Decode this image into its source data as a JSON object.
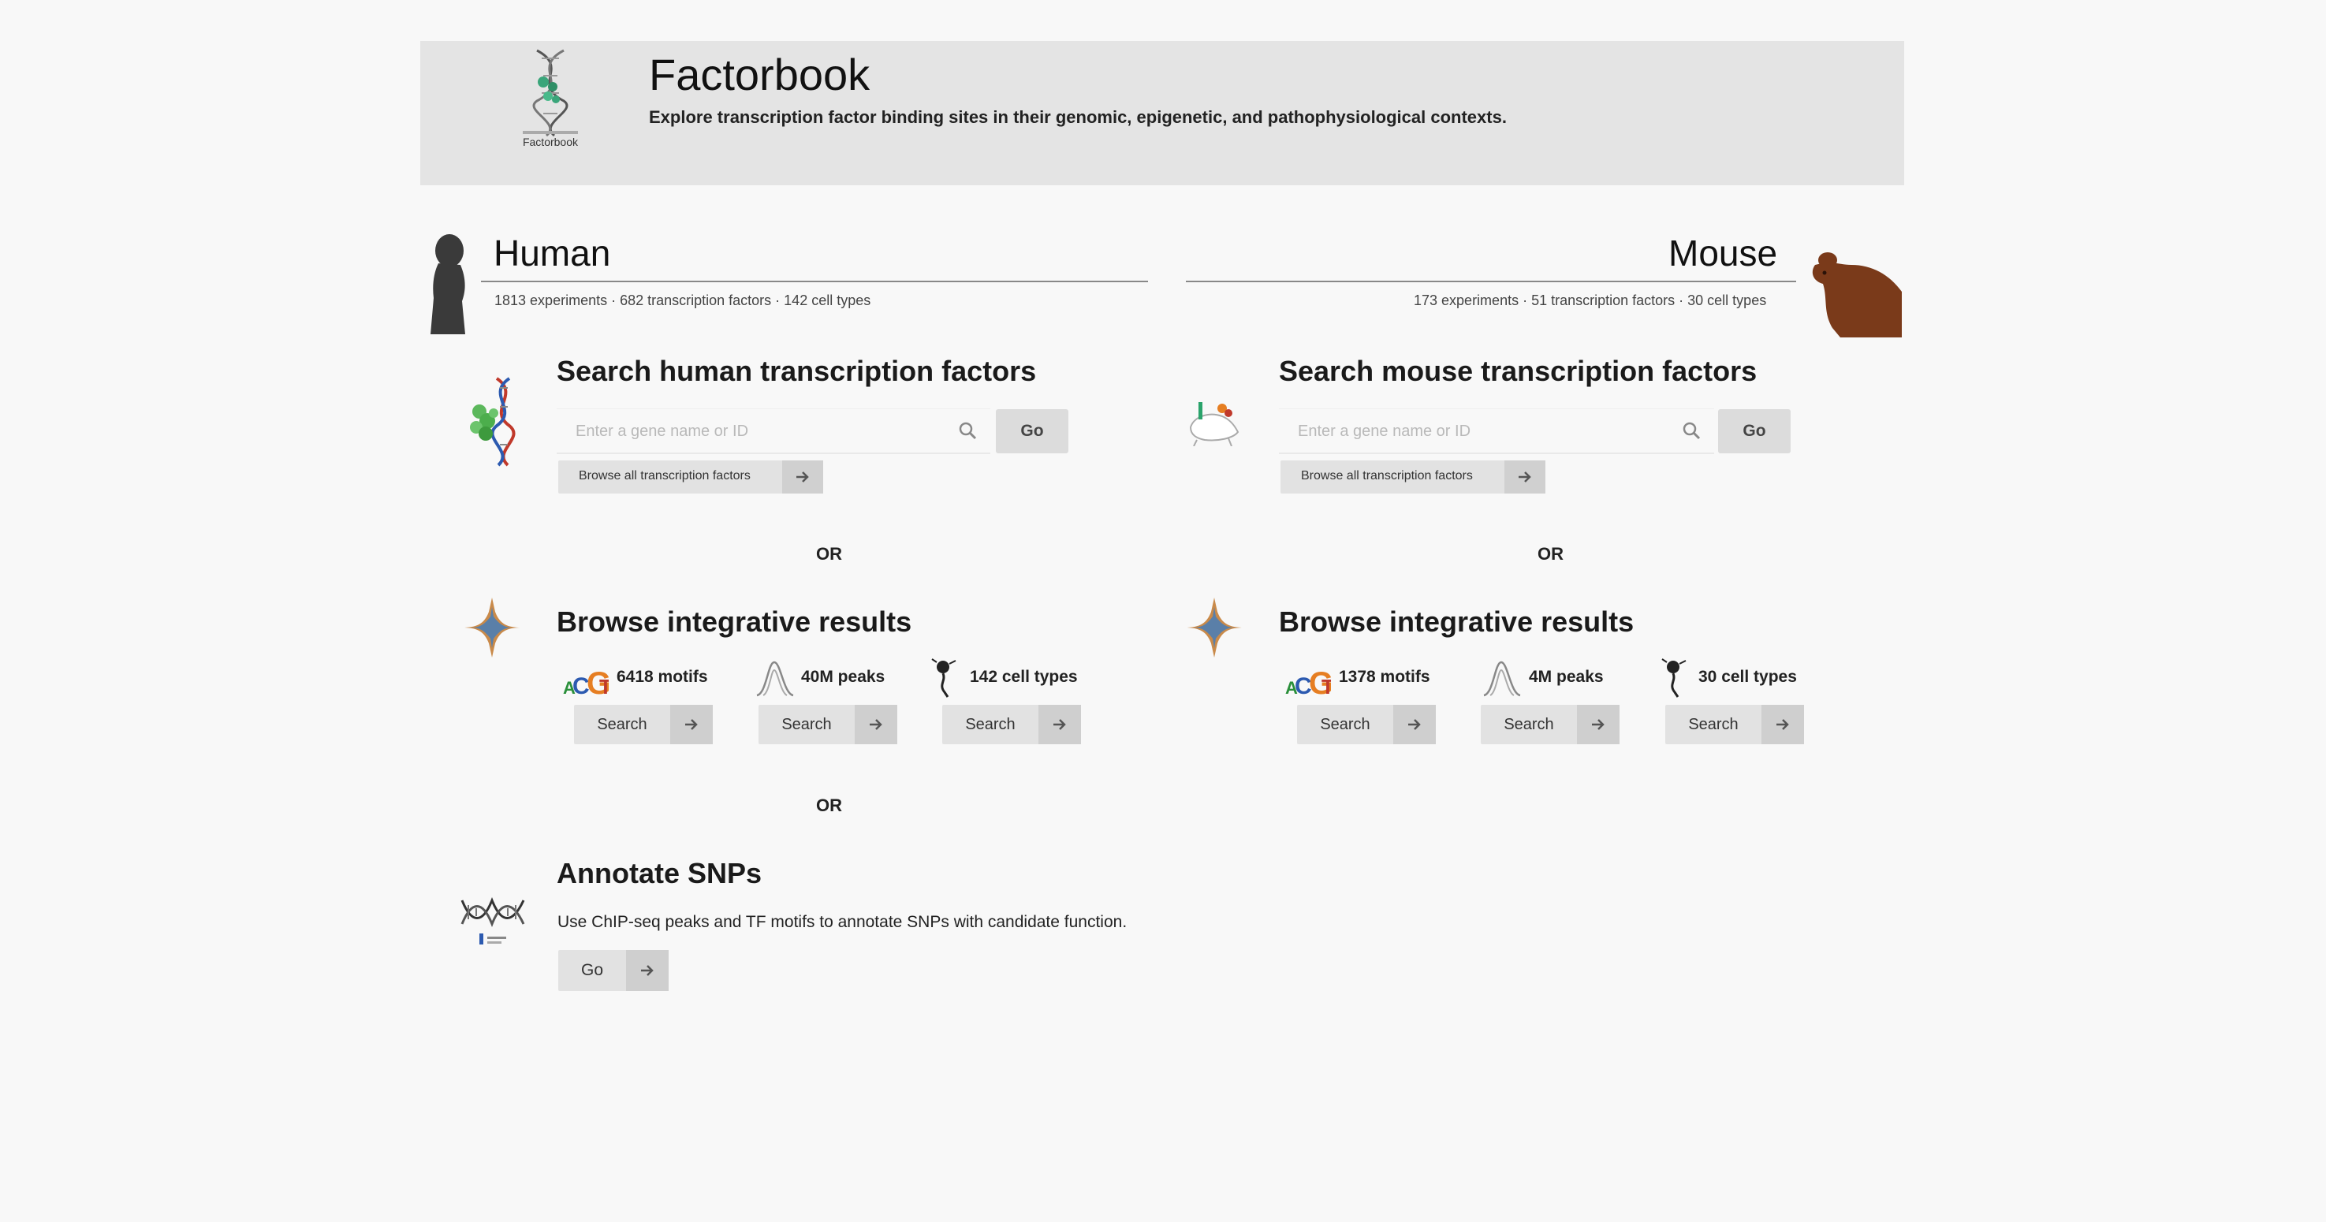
{
  "header": {
    "logo_caption": "Factorbook",
    "title": "Factorbook",
    "subtitle": "Explore transcription factor binding sites in their genomic, epigenetic, and pathophysiological contexts."
  },
  "human": {
    "name": "Human",
    "stats": "1813 experiments · 682 transcription factors · 142 cell types",
    "search_title": "Search human transcription factors",
    "search_placeholder": "Enter a gene name or ID",
    "go_label": "Go",
    "browse_all_label": "Browse all transcription factors",
    "or_1": "OR",
    "integrative_title": "Browse integrative results",
    "motifs_label": "6418 motifs",
    "peaks_label": "40M peaks",
    "celltypes_label": "142 cell types",
    "search_label": "Search",
    "or_2": "OR"
  },
  "mouse": {
    "name": "Mouse",
    "stats": "173 experiments · 51 transcription factors · 30 cell types",
    "search_title": "Search mouse transcription factors",
    "search_placeholder": "Enter a gene name or ID",
    "go_label": "Go",
    "browse_all_label": "Browse all transcription factors",
    "or_1": "OR",
    "integrative_title": "Browse integrative results",
    "motifs_label": "1378 motifs",
    "peaks_label": "4M peaks",
    "celltypes_label": "30 cell types",
    "search_label": "Search"
  },
  "snps": {
    "title": "Annotate SNPs",
    "description": "Use ChIP-seq peaks and TF motifs to annotate SNPs with candidate function.",
    "go_label": "Go"
  },
  "colors": {
    "page_bg": "#f8f8f8",
    "header_bg": "#e4e4e4",
    "button_bg": "#e2e2e2",
    "button_arrow_bg": "#cfcfcf",
    "mouse_brown": "#7a3a1a",
    "human_silhouette": "#3a3a3a"
  },
  "icons": {
    "logo": "dna-helix-logo-icon",
    "human": "human-silhouette-icon",
    "mouse": "mouse-silhouette-icon",
    "human_tf": "protein-dna-icon",
    "mouse_tf": "mouse-dna-icon",
    "integrative": "aggregate-peak-icon",
    "motif": "sequence-logo-icon",
    "peaks": "peak-curve-icon",
    "celltypes": "cell-icon",
    "search": "search-icon",
    "arrow": "arrow-right-icon",
    "snp": "snp-helix-icon"
  }
}
